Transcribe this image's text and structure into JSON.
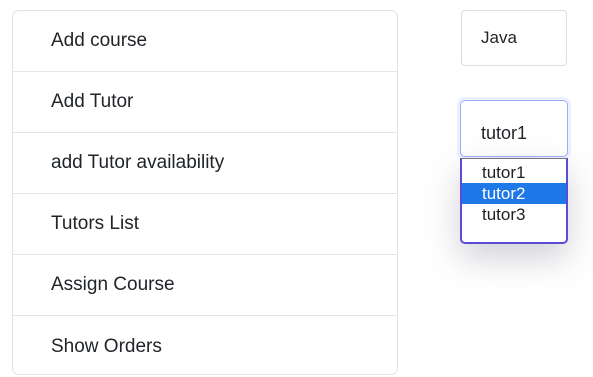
{
  "menu": {
    "items": [
      {
        "label": "Add course"
      },
      {
        "label": "Add Tutor"
      },
      {
        "label": "add Tutor availability"
      },
      {
        "label": "Tutors List"
      },
      {
        "label": "Assign Course"
      },
      {
        "label": "Show Orders"
      }
    ]
  },
  "course_field": {
    "value": "Java"
  },
  "tutor_select": {
    "value": "tutor1",
    "options": [
      "tutor1",
      "tutor2",
      "tutor3"
    ],
    "highlighted": "tutor2"
  },
  "colors": {
    "highlight": "#1e78e8",
    "focus_border": "#5b4cd6"
  }
}
